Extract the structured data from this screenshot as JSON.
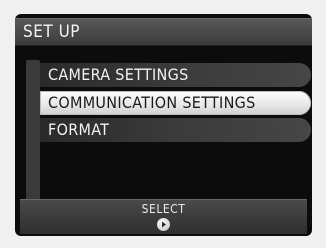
{
  "header": {
    "title": "SET UP"
  },
  "menu": {
    "items": [
      {
        "label": "CAMERA SETTINGS",
        "selected": false
      },
      {
        "label": "COMMUNICATION SETTINGS",
        "selected": true
      },
      {
        "label": "FORMAT",
        "selected": false
      }
    ]
  },
  "footer": {
    "select_label": "SELECT",
    "select_icon": "right-arrow-dial-icon"
  },
  "colors": {
    "background": "#0c0c0c",
    "selected_item": "#f2f2f2",
    "unselected_item": "#3a3a3a"
  }
}
